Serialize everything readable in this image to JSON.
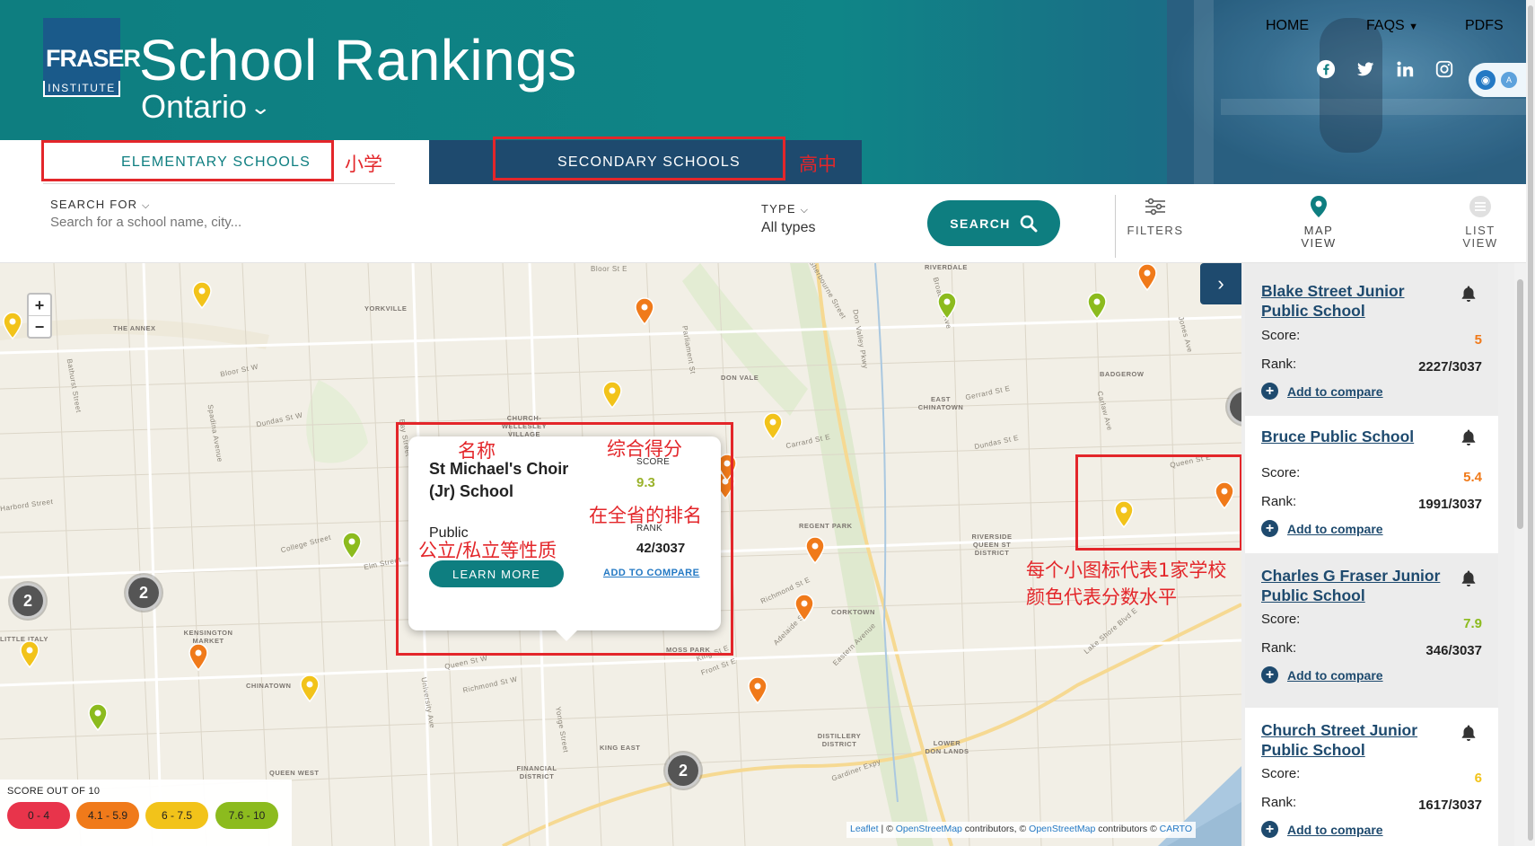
{
  "header": {
    "logo_line1": "FRASER",
    "logo_line2": "INSTITUTE",
    "title": "School Rankings",
    "province": "Ontario",
    "nav": [
      "HOME",
      "FAQS",
      "PDFS"
    ],
    "social_icons": [
      "facebook-icon",
      "twitter-icon",
      "linkedin-icon",
      "instagram-icon"
    ]
  },
  "tabs": {
    "elementary": "ELEMENTARY SCHOOLS",
    "secondary": "SECONDARY SCHOOLS"
  },
  "annotations": {
    "elementary": "小学",
    "secondary": "高中",
    "name": "名称",
    "score": "综合得分",
    "rank": "在全省的排名",
    "type": "公立/私立等性质",
    "pins_line1": "每个小图标代表1家学校",
    "pins_line2": "颜色代表分数水平"
  },
  "search": {
    "label": "SEARCH FOR",
    "placeholder": "Search for a school name, city...",
    "type_label": "TYPE",
    "type_value": "All types",
    "button": "SEARCH",
    "filters": "FILTERS",
    "map_view_1": "MAP",
    "map_view_2": "VIEW",
    "list_view_1": "LIST",
    "list_view_2": "VIEW"
  },
  "map": {
    "zoom_in": "+",
    "zoom_out": "−",
    "clusters": [
      "2",
      "2",
      "2"
    ],
    "place_labels": [
      "YORKVILLE",
      "THE ANNEX",
      "CHURCH-WELLESLEY VILLAGE",
      "DON VALE",
      "RIVERDALE",
      "BADGEROW",
      "EAST CHINATOWN",
      "REGENT PARK",
      "RIVERSIDE QUEEN ST DISTRICT",
      "CORKTOWN",
      "KENSINGTON MARKET",
      "LITTLE ITALY",
      "CHINATOWN",
      "QUEEN WEST",
      "FINANCIAL DISTRICT",
      "KING EAST",
      "MOSS PARK",
      "DISTILLERY DISTRICT",
      "LOWER DON LANDS"
    ],
    "street_labels": [
      "Bloor St W",
      "Bloor St E",
      "Queen St E",
      "College Street",
      "Gerrard St E",
      "Dundas St E",
      "Carrard St E",
      "Richmond St E",
      "Adelaide St E",
      "Front St E",
      "King St E",
      "Lake Shore Blvd E",
      "Eastern Avenue",
      "Harbord Street",
      "Spadina Avenue",
      "Bathurst Street",
      "Parliament St",
      "Sherbourne Street",
      "Yonge Street",
      "Bay Street",
      "University Ave",
      "Queen St W",
      "Richmond St W",
      "Don Valley Pkwy",
      "Broadview Ave",
      "Jones Ave",
      "Carlaw Ave",
      "Dundas St W",
      "Elm Street",
      "Gardiner Expy"
    ]
  },
  "popup": {
    "name": "St Michael's Choir (Jr) School",
    "score_label": "SCORE",
    "score_value": "9.3",
    "type": "Public",
    "rank_label": "RANK",
    "rank_value": "42/3037",
    "learn_more": "LEARN MORE",
    "add_compare": "ADD TO COMPARE"
  },
  "legend": {
    "title": "SCORE OUT OF 10",
    "ranges": [
      {
        "label": "0 - 4",
        "color": "#e8344b"
      },
      {
        "label": "4.1 - 5.9",
        "color": "#f07a1a"
      },
      {
        "label": "6 - 7.5",
        "color": "#f2c31a"
      },
      {
        "label": "7.6 - 10",
        "color": "#8cbb1e"
      }
    ]
  },
  "attribution": {
    "leaflet": "Leaflet",
    "sep1": " | © ",
    "osm1": "OpenStreetMap",
    "mid": " contributors, © ",
    "osm2": "OpenStreetMap",
    "end": " contributors © ",
    "carto": "CARTO"
  },
  "side_list": [
    {
      "name": "Blake Street Junior Public School",
      "score_label": "Score:",
      "score": "5",
      "score_color": "#f07a1a",
      "rank_label": "Rank:",
      "rank": "2227/3037",
      "add": "Add to compare"
    },
    {
      "name": "Bruce Public School",
      "score_label": "Score:",
      "score": "5.4",
      "score_color": "#f07a1a",
      "rank_label": "Rank:",
      "rank": "1991/3037",
      "add": "Add to compare"
    },
    {
      "name": "Charles G Fraser Junior Public School",
      "score_label": "Score:",
      "score": "7.9",
      "score_color": "#8cbb1e",
      "rank_label": "Rank:",
      "rank": "346/3037",
      "add": "Add to compare"
    },
    {
      "name": "Church Street Junior Public School",
      "score_label": "Score:",
      "score": "6",
      "score_color": "#f2c31a",
      "rank_label": "Rank:",
      "rank": "1617/3037",
      "add": "Add to compare"
    }
  ]
}
